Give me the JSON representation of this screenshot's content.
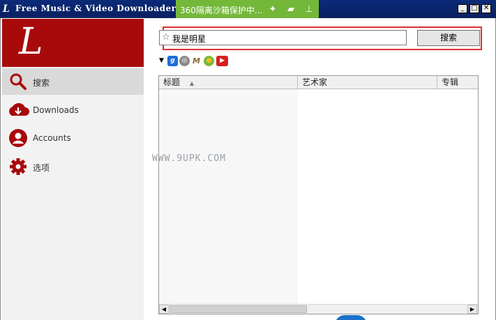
{
  "window": {
    "title": "Free Music & Video Downloader [1.",
    "app_icon": "L",
    "controls": [
      "minimize",
      "maximize",
      "close"
    ]
  },
  "sandbox_bar": {
    "text": "360隔离沙箱保护中...",
    "icons": [
      "puzzle-icon",
      "folder-icon",
      "pin-icon"
    ],
    "color": "#74b83a"
  },
  "sidebar": {
    "logo": "L",
    "brand_color": "#a8090b",
    "items": [
      {
        "label": "搜索",
        "icon": "search-icon",
        "active": true
      },
      {
        "label": "Downloads",
        "icon": "download-icon",
        "active": false
      },
      {
        "label": "Accounts",
        "icon": "user-icon",
        "active": false
      },
      {
        "label": "选项",
        "icon": "gear-icon",
        "active": false
      }
    ]
  },
  "search": {
    "value": "我是明星",
    "button_label": "搜索"
  },
  "sources": [
    {
      "name": "music-source-icon",
      "glyph": "g",
      "color": "#1e6fd6"
    },
    {
      "name": "cd-source-icon",
      "glyph": "◎",
      "color": "#888888"
    },
    {
      "name": "m-source-icon",
      "glyph": "M",
      "color": "#b88f4a"
    },
    {
      "name": "globe-source-icon",
      "glyph": "●",
      "color": "#7ab93a"
    },
    {
      "name": "youtube-source-icon",
      "glyph": "▶",
      "color": "#d61f1f"
    }
  ],
  "table": {
    "columns": [
      "标题",
      "艺术家",
      "专辑"
    ],
    "sorted_column": "标题",
    "rows": []
  },
  "watermark": "WWW.9UPK.COM"
}
